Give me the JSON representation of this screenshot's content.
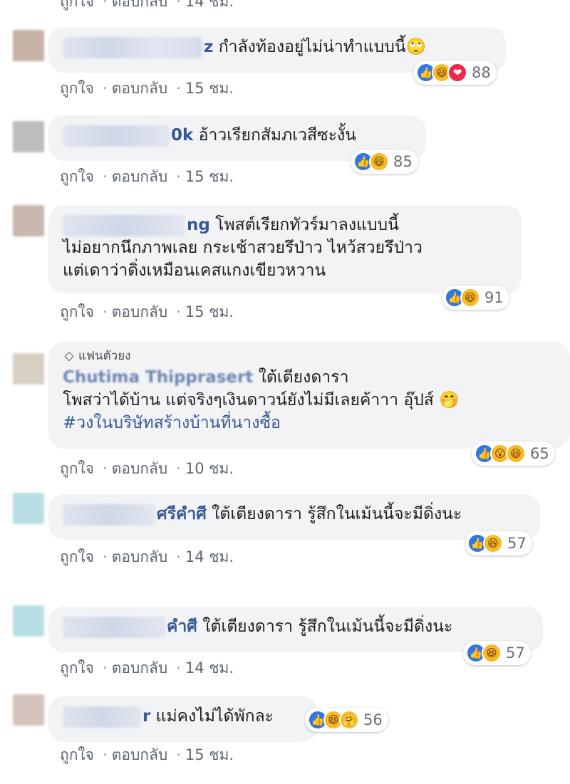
{
  "comments": [
    {
      "avatar_color": "#c7b2a8",
      "name_tail": "z",
      "text_lines": [
        "กำลังท้องอยู่ไม่น่าทำแบบนี้🙄"
      ],
      "reactions": [
        "like",
        "haha",
        "love"
      ],
      "reaction_count": "88",
      "actions": {
        "like": "ถูกใจ",
        "reply": "ตอบกลับ",
        "time": "15 ชม."
      }
    },
    {
      "avatar_color": "#bdbdbd",
      "name_tail": "0k",
      "text_lines": [
        "อ้าวเรียกสัมภเวสีซะงั้น"
      ],
      "reactions": [
        "like",
        "haha"
      ],
      "reaction_count": "85",
      "actions": {
        "like": "ถูกใจ",
        "reply": "ตอบกลับ",
        "time": "15 ชม."
      }
    },
    {
      "avatar_color": "#c9b7ae",
      "name_tail": "ng",
      "text_lines": [
        "โพสต์เรียกทัวร์มาลงแบบนี้",
        "ไม่อยากนึกภาพเลย กระเช้าสวยรึป่าว ไหว้สวยรึป่าว",
        "แต่เดาว่าดิ่งเหมือนเคสแกงเขียวหวาน"
      ],
      "reactions": [
        "like",
        "haha"
      ],
      "reaction_count": "91",
      "actions": {
        "like": "ถูกใจ",
        "reply": "ตอบกลับ",
        "time": "15 ชม."
      }
    },
    {
      "avatar_color": "#d8cfc3",
      "badge": "แฟนตัวยง",
      "badge_icon": "diamond-icon",
      "name_tail": "Chutima Thipprasert",
      "text_lines": [
        "ใต้เตียงดารา",
        "โพสว่าได้บ้าน แต่จริงๆเงินดาวน์ยังไม่มีเลยค้าาา อุ๊ปส์ 🤭",
        "#วงในบริษัทสร้างบ้านที่นางซื้อ"
      ],
      "reactions": [
        "like",
        "wow",
        "haha"
      ],
      "reaction_count": "65",
      "actions": {
        "like": "ถูกใจ",
        "reply": "ตอบกลับ",
        "time": "10 ชม."
      }
    },
    {
      "avatar_color": "#b9dfe6",
      "name_tail": "ศรีคำศี",
      "text_lines": [
        "ใต้เตียงดารา รู้สึกในเม้นนี้จะมีดิ่งนะ"
      ],
      "reactions": [
        "like",
        "haha"
      ],
      "reaction_count": "57",
      "actions": {
        "like": "ถูกใจ",
        "reply": "ตอบกลับ",
        "time": "14 ชม."
      }
    },
    {
      "avatar_color": "#b9dfe6",
      "name_tail": "คำศี",
      "text_lines": [
        "ใต้เตียงดารา รู้สึกในเม้นนี้จะมีดิ่งนะ"
      ],
      "reactions": [
        "like",
        "haha"
      ],
      "reaction_count": "57",
      "actions": {
        "like": "ถูกใจ",
        "reply": "ตอบกลับ",
        "time": "14 ชม."
      }
    },
    {
      "avatar_color": "#d5c4bd",
      "name_tail": "r",
      "text_lines": [
        "แม่คงไม่ได้พักละ"
      ],
      "reactions": [
        "like",
        "haha",
        "care"
      ],
      "reaction_count": "56",
      "actions": {
        "like": "ถูกใจ",
        "reply": "ตอบกลับ",
        "time": "15 ชม."
      }
    }
  ],
  "top_partial_actions": {
    "like": "ถูกใจ",
    "reply": "ตอบกลับ",
    "time": "14 ชม."
  },
  "colors": {
    "bubble_bg": "#f2f3f5",
    "name_link": "#385898",
    "action_text": "#606770",
    "like_blue": "#2f76e6",
    "haha_yellow": "#f7b928",
    "love_red": "#f0284a"
  }
}
